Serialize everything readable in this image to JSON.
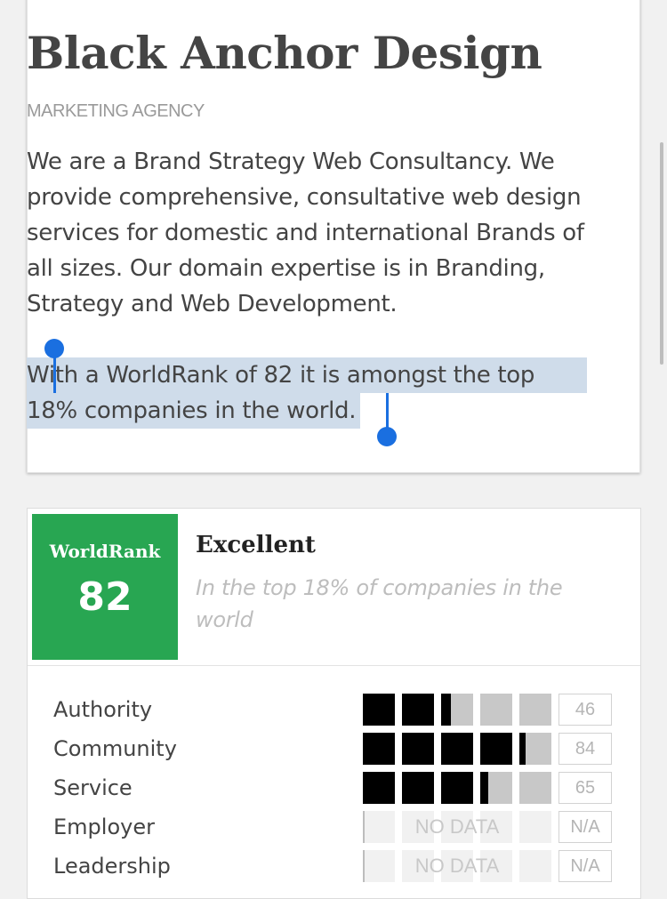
{
  "company": {
    "name": "Black Anchor Design",
    "category": "MARKETING AGENCY",
    "description": "We are a Brand Strategy Web Consultancy. We provide comprehensive, consultative web design services for domestic and international Brands of all sizes. Our domain expertise is in Branding, Strategy and Web Development.",
    "rank_sentence_line1": "With a WorldRank of 82 it is amongst the top",
    "rank_sentence_line2": "18% companies in the world."
  },
  "worldrank": {
    "label": "WorldRank",
    "value": "82",
    "rating": "Excellent",
    "rating_description": "In the top 18% of companies in the world",
    "color": "#28a652"
  },
  "metrics": [
    {
      "label": "Authority",
      "score": "46",
      "level": 0.46,
      "has_data": true
    },
    {
      "label": "Community",
      "score": "84",
      "level": 0.84,
      "has_data": true
    },
    {
      "label": "Service",
      "score": "65",
      "level": 0.65,
      "has_data": true
    },
    {
      "label": "Employer",
      "score": "N/A",
      "has_data": false,
      "nodata_text": "NO DATA"
    },
    {
      "label": "Leadership",
      "score": "N/A",
      "has_data": false,
      "nodata_text": "NO DATA"
    }
  ],
  "selection_color": "#1a6fe0"
}
